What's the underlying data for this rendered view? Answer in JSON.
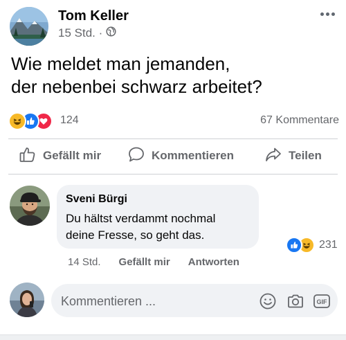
{
  "post": {
    "author": "Tom Keller",
    "time": "15 Std. ·",
    "text_line1": "Wie meldet man jemanden,",
    "text_line2": "der nebenbei schwarz arbeitet?",
    "reaction_count": "124",
    "comment_count": "67 Kommentare"
  },
  "actions": {
    "like": "Gefällt mir",
    "comment": "Kommentieren",
    "share": "Teilen"
  },
  "comment": {
    "author": "Sveni Bürgi",
    "text_line1": "Du hältst verdammt nochmal",
    "text_line2": "deine Fresse, so geht das.",
    "reaction_count": "231",
    "time": "14 Std.",
    "like": "Gefällt mir",
    "reply": "Antworten"
  },
  "composer": {
    "placeholder": "Kommentieren ..."
  },
  "icons": {
    "post_reactions": [
      "haha-icon",
      "like-icon",
      "love-icon"
    ],
    "comment_reactions": [
      "like-icon",
      "haha-icon"
    ],
    "composer": [
      "emoji-icon",
      "camera-icon",
      "gif-icon"
    ]
  },
  "colors": {
    "like_blue": "#1877f2",
    "love_red": "#f02849",
    "haha_yellow": "#f7b928",
    "text_secondary": "#65676b"
  }
}
